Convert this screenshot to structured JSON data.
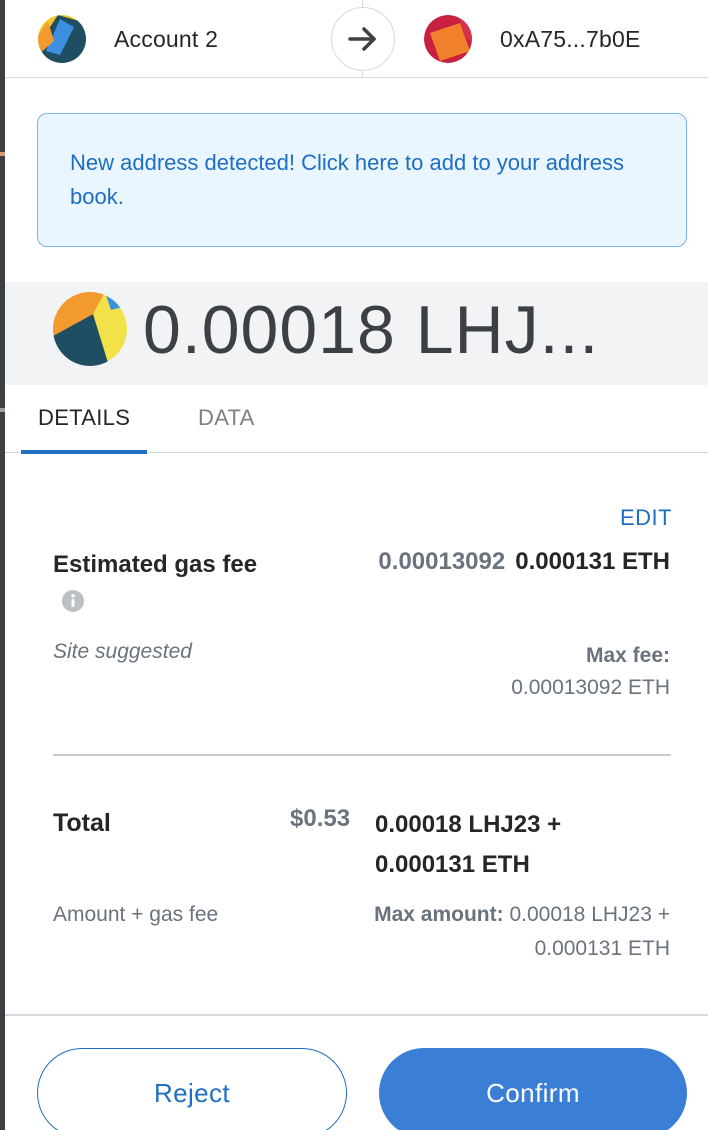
{
  "header": {
    "from_account": "Account 2",
    "to_account": "0xA75...7b0E"
  },
  "banner": {
    "text": "New address detected! Click here to add to your address book."
  },
  "amount": {
    "text": "0.00018 LHJ..."
  },
  "tabs": [
    {
      "label": "DETAILS",
      "active": true
    },
    {
      "label": "DATA",
      "active": false
    }
  ],
  "gas": {
    "edit_label": "EDIT",
    "label": "Estimated gas fee",
    "secondary_value": "0.00013092",
    "primary_value": "0.000131 ETH",
    "site_suggested": "Site suggested",
    "max_fee_label": "Max fee:",
    "max_fee_value": "0.00013092 ETH"
  },
  "total": {
    "label": "Total",
    "usd": "$0.53",
    "crypto": "0.00018 LHJ23 + 0.000131 ETH",
    "amount_gas_label": "Amount + gas fee",
    "max_amount_label": "Max amount:",
    "max_amount_value": "0.00018 LHJ23 + 0.000131 ETH"
  },
  "buttons": {
    "reject": "Reject",
    "confirm": "Confirm"
  },
  "colors": {
    "accent": "#1f6ec2",
    "confirm_bg": "#3a7fd5",
    "banner_bg": "#eaf6ff",
    "banner_border": "#75b8ec"
  }
}
